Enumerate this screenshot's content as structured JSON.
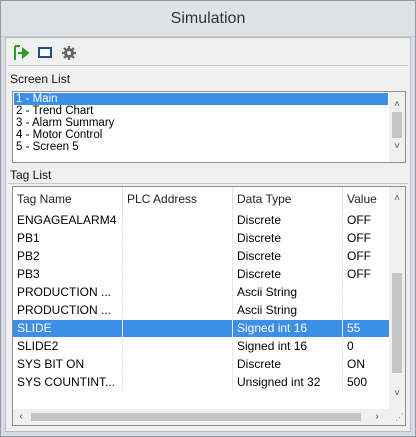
{
  "window": {
    "title": "Simulation"
  },
  "toolbar": {
    "icons": [
      "run-icon",
      "screen-icon",
      "settings-gear-icon"
    ]
  },
  "screen_list": {
    "label": "Screen List",
    "items": [
      "1 - Main",
      "2 - Trend Chart",
      "3 - Alarm Summary",
      "4 - Motor Control",
      "5 - Screen 5"
    ],
    "selected_index": 0
  },
  "tag_list": {
    "label": "Tag List",
    "columns": [
      "Tag Name",
      "PLC Address",
      "Data Type",
      "Value"
    ],
    "rows": [
      [
        "ENGAGEALARM4",
        "",
        "Discrete",
        "OFF"
      ],
      [
        "PB1",
        "",
        "Discrete",
        "OFF"
      ],
      [
        "PB2",
        "",
        "Discrete",
        "OFF"
      ],
      [
        "PB3",
        "",
        "Discrete",
        "OFF"
      ],
      [
        "PRODUCTION ...",
        "",
        "Ascii String",
        ""
      ],
      [
        "PRODUCTION ...",
        "",
        "Ascii String",
        ""
      ],
      [
        "SLIDE",
        "",
        "Signed int 16",
        "55"
      ],
      [
        "SLIDE2",
        "",
        "Signed int 16",
        "0"
      ],
      [
        "SYS BIT ON",
        "",
        "Discrete",
        "ON"
      ],
      [
        "SYS COUNTINT...",
        "",
        "Unsigned int 32",
        "500"
      ]
    ],
    "selected_index": 6
  },
  "colors": {
    "selection": "#3d8ee6",
    "run_icon": "#2e9a2e",
    "screen_icon": "#1f4f8f"
  }
}
